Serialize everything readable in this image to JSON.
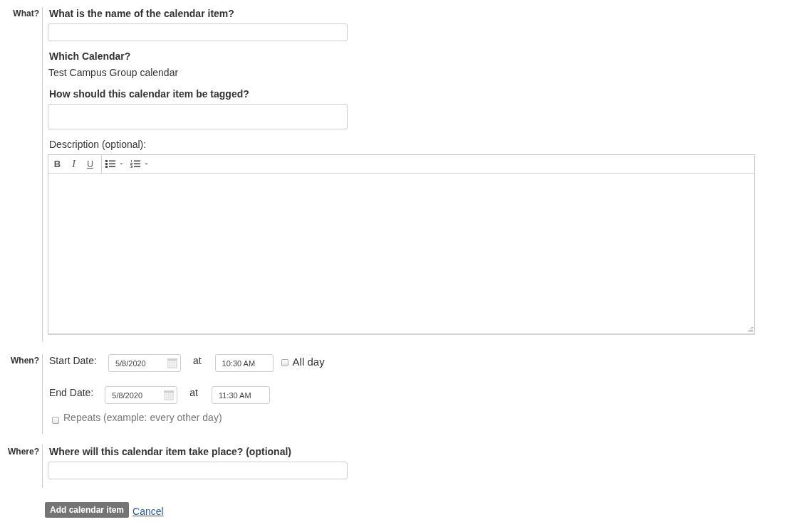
{
  "what_section": {
    "label": "What?",
    "name_question": "What is the name of the calendar item?",
    "calendar_heading": "Which Calendar?",
    "calendar_value": "Test Campus Group calendar",
    "tags_question": "How should this calendar item be tagged?",
    "description_label": "Description (optional):",
    "editor_toolbar": [
      [
        {
          "kind": "bold",
          "label": "B"
        },
        {
          "kind": "italic",
          "label": "I"
        },
        {
          "kind": "underline",
          "label": "U"
        }
      ],
      [
        {
          "kind": "bullet_list"
        },
        {
          "kind": "numbered_list"
        }
      ]
    ]
  },
  "when_section": {
    "label": "When?",
    "start": {
      "label": "Start Date:",
      "date": "5/8/2020",
      "at": "at",
      "time": "10:30 AM"
    },
    "all_day": {
      "label": "All day",
      "checked": false
    },
    "end": {
      "label": "End Date:",
      "date": "5/8/2020",
      "at": "at",
      "time": "11:30 AM"
    },
    "repeats": {
      "label": "Repeats (example: every other day)",
      "checked": false
    }
  },
  "where_section": {
    "label": "Where?",
    "question": "Where will this calendar item take place? (optional)"
  },
  "actions": {
    "submit": "Add calendar item",
    "cancel": "Cancel"
  }
}
